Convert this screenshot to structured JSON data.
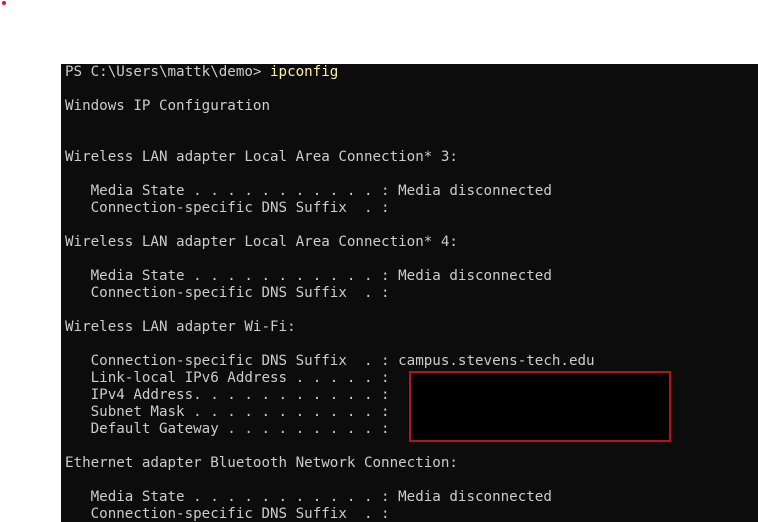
{
  "prompt": "PS C:\\Users\\mattk\\demo> ",
  "command": "ipconfig",
  "lines": [
    "Windows IP Configuration",
    "Wireless LAN adapter Local Area Connection* 3:",
    "   Media State . . . . . . . . . . . : Media disconnected",
    "   Connection-specific DNS Suffix  . :",
    "Wireless LAN adapter Local Area Connection* 4:",
    "   Media State . . . . . . . . . . . : Media disconnected",
    "   Connection-specific DNS Suffix  . :",
    "Wireless LAN adapter Wi-Fi:",
    "   Connection-specific DNS Suffix  . : campus.stevens-tech.edu",
    "   Link-local IPv6 Address . . . . . :",
    "   IPv4 Address. . . . . . . . . . . :",
    "   Subnet Mask . . . . . . . . . . . :",
    "   Default Gateway . . . . . . . . . :",
    "Ethernet adapter Bluetooth Network Connection:",
    "   Media State . . . . . . . . . . . : Media disconnected",
    "   Connection-specific DNS Suffix  . :"
  ],
  "colors": {
    "terminal_bg": "#0c0c0c",
    "text": "#cccccc",
    "command": "#f9f1a5",
    "redaction_border": "#b3141b"
  }
}
